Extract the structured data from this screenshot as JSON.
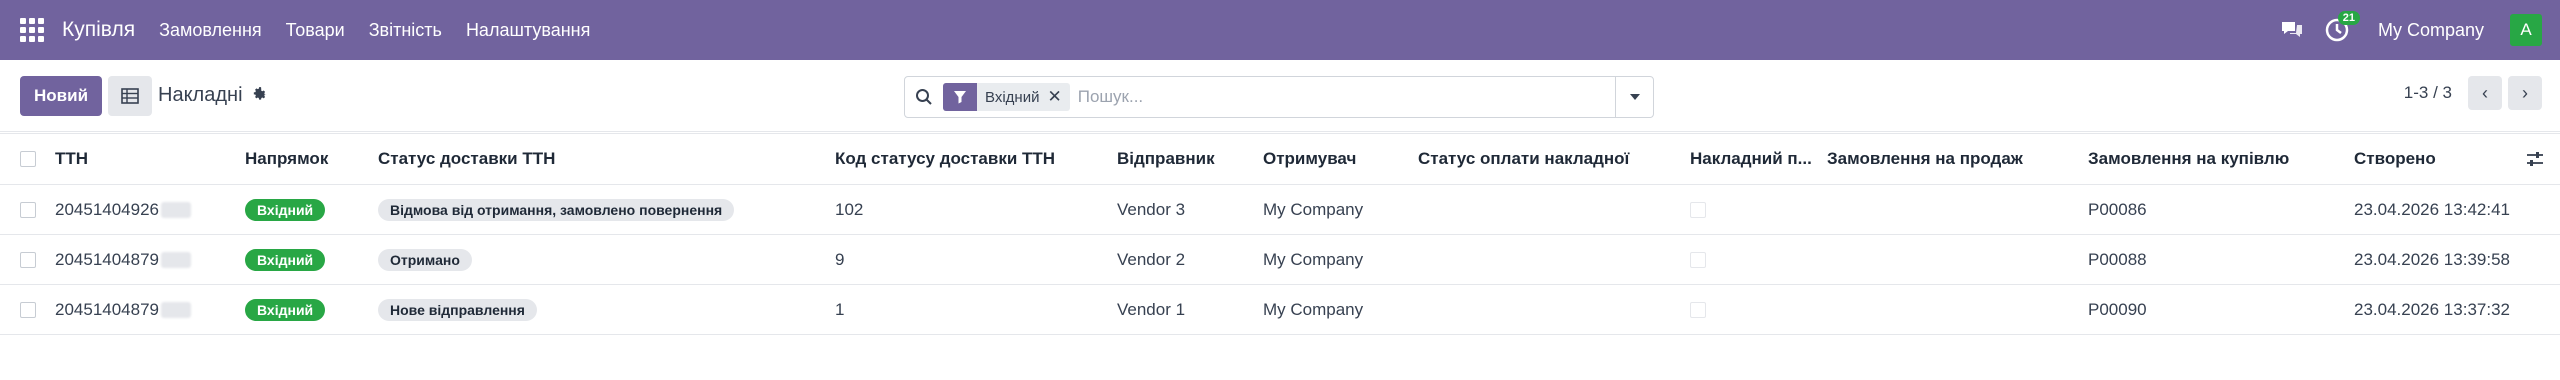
{
  "navbar": {
    "brand": "Купівля",
    "menu": [
      "Замовлення",
      "Товари",
      "Звітність",
      "Налаштування"
    ],
    "activity_count": "21",
    "company": "My Company",
    "avatar_letter": "A",
    "bg_color": "#71639e",
    "avatar_color": "#28a745"
  },
  "control": {
    "new_label": "Новий",
    "title": "Накладні",
    "search": {
      "facet_value": "Вхідний",
      "facet_remove": "✕",
      "placeholder": "Пошук..."
    },
    "pager": {
      "value": "1-3 / 3",
      "prev": "‹",
      "next": "›"
    }
  },
  "table": {
    "columns": {
      "ttn": "ТТН",
      "direction": "Напрямок",
      "status": "Статус доставки ТТН",
      "status_code": "Код статусу доставки ТТН",
      "sender": "Відправник",
      "recipient": "Отримувач",
      "payment_status": "Статус оплати накладної",
      "cod": "Накладний п...",
      "sale_order": "Замовлення на продаж",
      "purchase_order": "Замовлення на купівлю",
      "created": "Створено"
    },
    "rows": [
      {
        "ttn": "20451404926",
        "direction": "Вхідний",
        "status": "Відмова від отримання, замовлено повернення",
        "status_code": "102",
        "sender": "Vendor 3",
        "recipient": "My Company",
        "purchase_order": "P00086",
        "created": "23.04.2026 13:42:41"
      },
      {
        "ttn": "20451404879",
        "direction": "Вхідний",
        "status": "Отримано",
        "status_code": "9",
        "sender": "Vendor 2",
        "recipient": "My Company",
        "purchase_order": "P00088",
        "created": "23.04.2026 13:39:58"
      },
      {
        "ttn": "20451404879",
        "direction": "Вхідний",
        "status": "Нове відправлення",
        "status_code": "1",
        "sender": "Vendor 1",
        "recipient": "My Company",
        "purchase_order": "P00090",
        "created": "23.04.2026 13:37:32"
      }
    ]
  },
  "icons": {
    "apps": "apps-grid-icon",
    "chat": "chat-icon",
    "activity": "activity-clock-icon",
    "view": "list-view-icon",
    "gear": "gear-icon",
    "search": "search-icon",
    "filter": "filter-icon",
    "dropdown": "caret-down-icon",
    "optional_columns": "sliders-icon"
  }
}
